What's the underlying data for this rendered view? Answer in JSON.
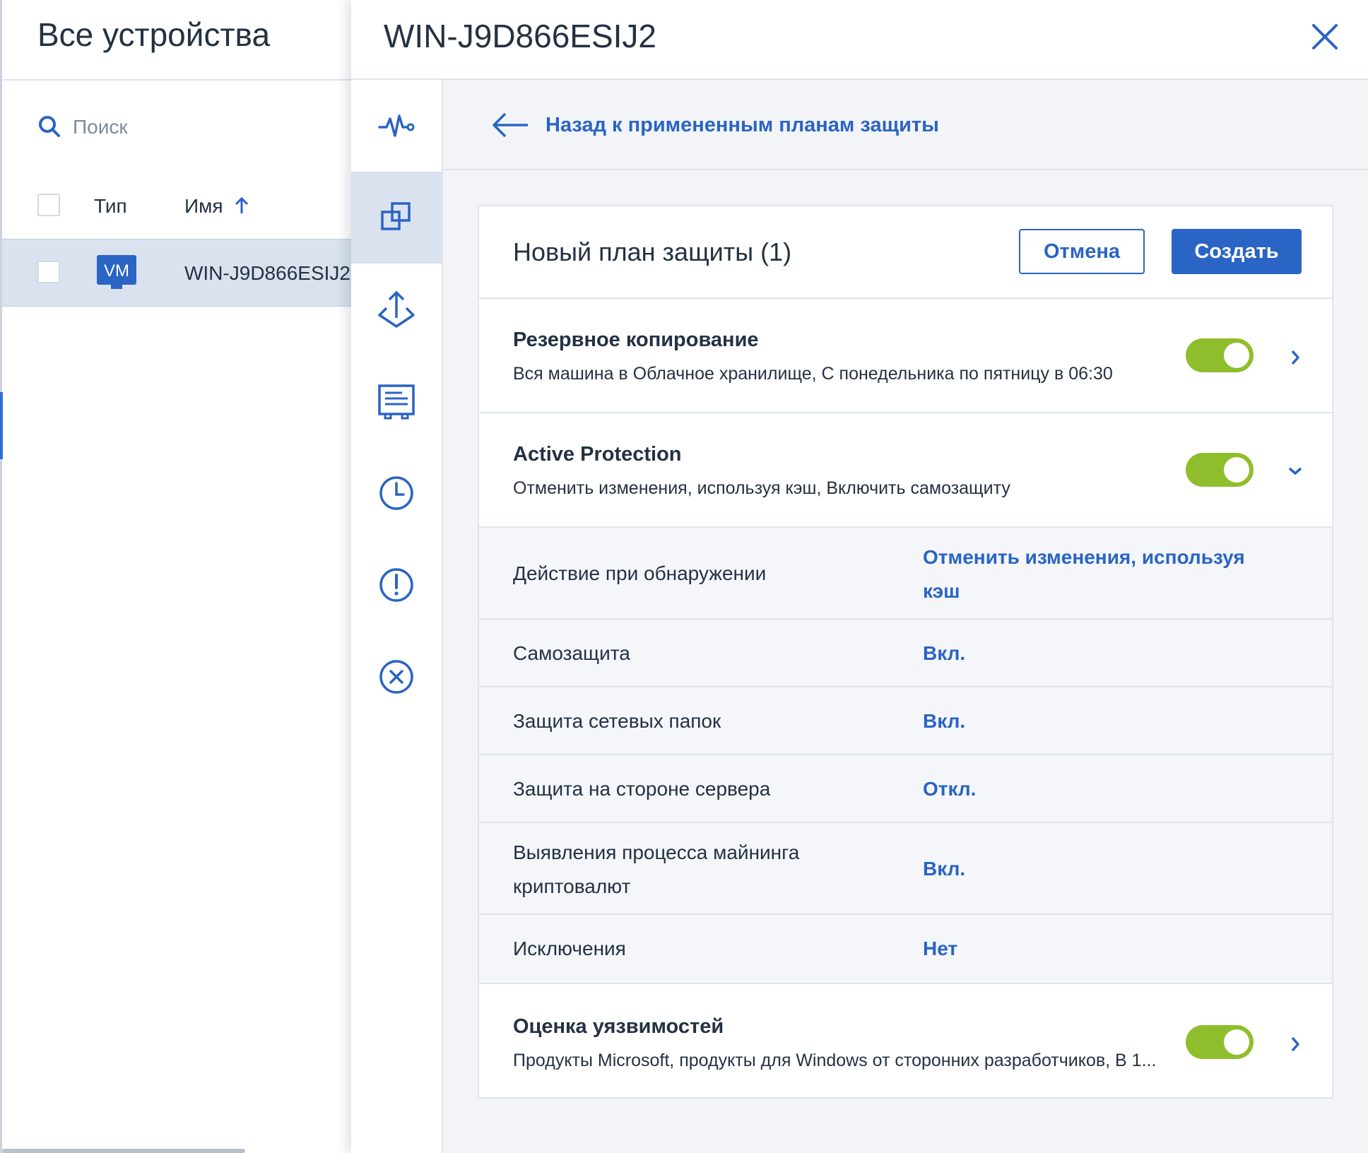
{
  "left_panel": {
    "title": "Все устройства",
    "search_placeholder": "Поиск",
    "columns": {
      "type": "Тип",
      "name": "Имя"
    },
    "devices": [
      {
        "type_badge": "VM",
        "name": "WIN-J9D866ESIJ2"
      }
    ]
  },
  "detail": {
    "device_title": "WIN-J9D866ESIJ2",
    "tabs": [
      {
        "name": "activity-icon"
      },
      {
        "name": "protection-plans-icon",
        "active": true
      },
      {
        "name": "recovery-icon"
      },
      {
        "name": "details-icon"
      },
      {
        "name": "history-icon"
      },
      {
        "name": "alerts-icon"
      },
      {
        "name": "errors-icon"
      }
    ],
    "back_link": "Назад к примененным планам защиты",
    "plan": {
      "title": "Новый план защиты (1)",
      "cancel_label": "Отмена",
      "create_label": "Создать",
      "modules": {
        "backup": {
          "title": "Резервное копирование",
          "description": "Вся машина в Облачное хранилище, С понедельника по пятницу в 06:30",
          "enabled": true
        },
        "active_protection": {
          "title": "Active Protection",
          "description": "Отменить изменения, используя кэш, Включить самозащиту",
          "enabled": true,
          "expanded": true,
          "settings": [
            {
              "label_line1": "Действие при обнаружении",
              "value_line1": "Отменить изменения, используя",
              "value_line2": "кэш"
            },
            {
              "label_line1": "Самозащита",
              "value_line1": "Вкл."
            },
            {
              "label_line1": "Защита сетевых папок",
              "value_line1": "Вкл."
            },
            {
              "label_line1": "Защита на стороне сервера",
              "value_line1": "Откл."
            },
            {
              "label_line1": "Выявления процесса майнинга",
              "label_line2": "криптовалют",
              "value_line1": "Вкл."
            },
            {
              "label_line1": "Исключения",
              "value_line1": "Нет"
            }
          ]
        },
        "vulnerability": {
          "title": "Оценка уязвимостей",
          "description": "Продукты Microsoft, продукты для Windows от сторонних разработчиков, В 1...",
          "enabled": true
        }
      }
    }
  },
  "colors": {
    "accent": "#2a64c4",
    "toggle_on": "#8fbe2d",
    "selected_row": "#d9e2ee",
    "panel_bg": "#f2f4f7"
  }
}
